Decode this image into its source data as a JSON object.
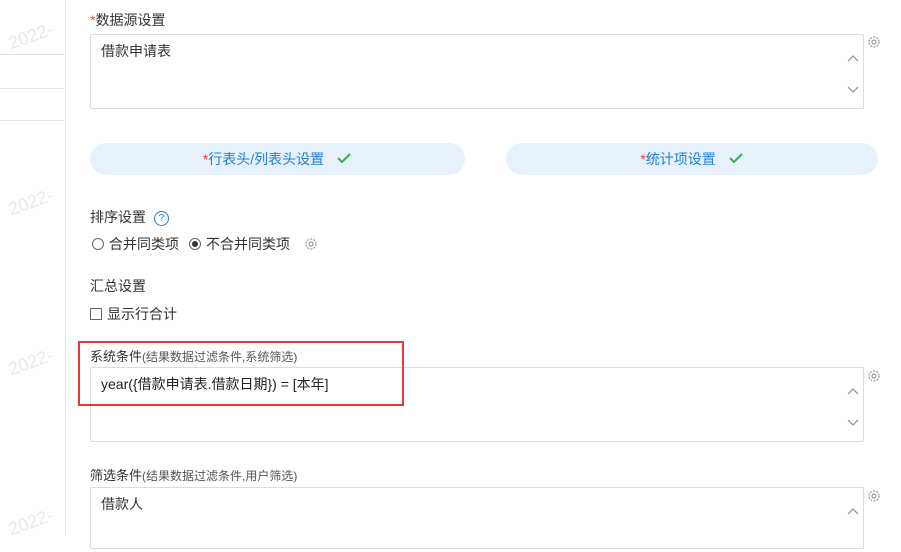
{
  "watermark": "2022-",
  "datasource": {
    "label": "数据源设置",
    "value": "借款申请表"
  },
  "pills": {
    "rowcol_label": "行表头/列表头设置",
    "stat_label": "统计项设置",
    "check_mark": "✓"
  },
  "sort": {
    "label": "排序设置",
    "help": "?",
    "option_merge": "合并同类项",
    "option_no_merge": "不合并同类项"
  },
  "summary": {
    "label": "汇总设置",
    "checkbox_label": "显示行合计"
  },
  "system_condition": {
    "label": "系统条件",
    "hint": "(结果数据过滤条件,系统筛选)",
    "value": "year({借款申请表.借款日期}) = [本年]"
  },
  "filter_condition": {
    "label": "筛选条件",
    "hint": "(结果数据过滤条件,用户筛选)",
    "value": "借款人"
  },
  "required_mark": "*",
  "colors": {
    "accent": "#1f7fd9",
    "pill_bg": "#e7f1fb",
    "check": "#2fb34a",
    "required": "#ff3b30",
    "highlight": "#e23a3a"
  }
}
